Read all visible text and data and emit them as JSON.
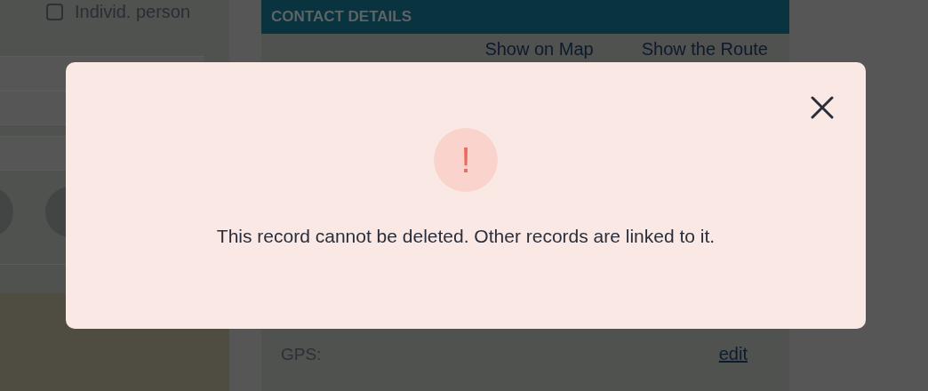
{
  "form": {
    "individual_person": {
      "label": "Individ. person",
      "checked": false
    }
  },
  "contact_details": {
    "title": "CONTACT DETAILS",
    "links": [
      "Show on Map",
      "Show the Route"
    ],
    "gps_label": "GPS:",
    "gps_link": "edit"
  },
  "dialog": {
    "icon": "!",
    "message": "This record cannot be deleted. Other records are linked to it."
  }
}
